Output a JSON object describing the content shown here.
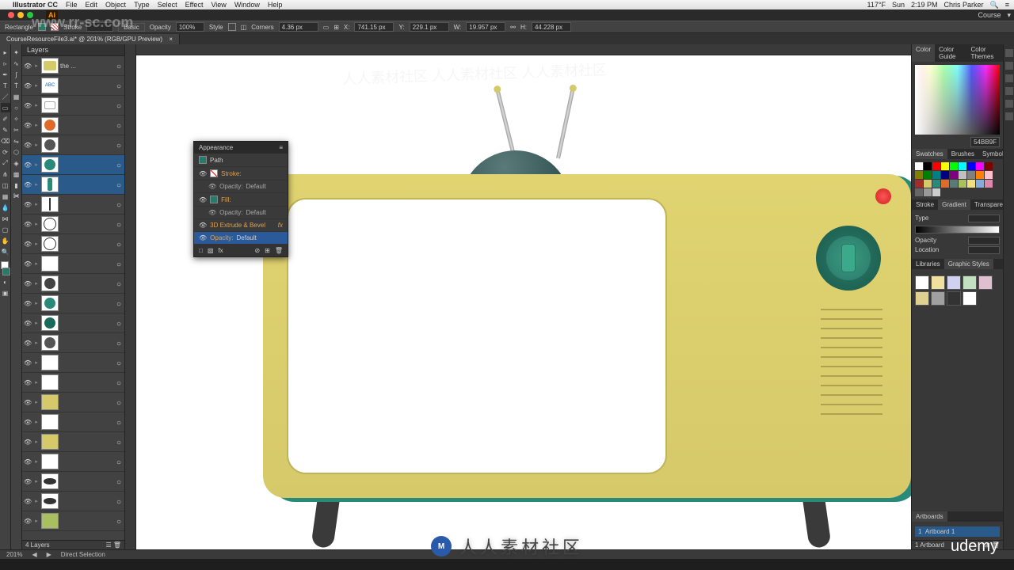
{
  "mac": {
    "app": "Illustrator CC",
    "menus": [
      "File",
      "Edit",
      "Object",
      "Type",
      "Select",
      "Effect",
      "View",
      "Window",
      "Help"
    ],
    "right": {
      "temp": "117°F",
      "day": "Sun",
      "time": "2:19 PM",
      "user": "Chris Parker"
    }
  },
  "app_right_menu": {
    "workspace": "Course"
  },
  "ctrl": {
    "tool": "Rectangle",
    "stroke": "Stroke",
    "style_lbl": "Style",
    "opacity_lbl": "Opacity",
    "opacity": "100%",
    "corners_lbl": "Corners",
    "corners": "4.36 px",
    "x": "741.15 px",
    "y": "229.1 px",
    "w": "19.957 px",
    "h": "44.228 px",
    "basic": "Basic"
  },
  "doc": {
    "tab": "CourseResourceFile3.ai* @ 201% (RGB/GPU Preview)"
  },
  "layers": {
    "title": "Layers",
    "items": [
      {
        "name": "the ...",
        "thumb": "tv",
        "sel": false
      },
      {
        "name": "",
        "thumb": "title",
        "sel": false
      },
      {
        "name": "",
        "thumb": "screen",
        "sel": false
      },
      {
        "name": "",
        "thumb": "circle",
        "color": "#e06a2a",
        "sel": false
      },
      {
        "name": "",
        "thumb": "circle",
        "color": "#555",
        "sel": false
      },
      {
        "name": "",
        "thumb": "circle",
        "color": "#2a8a7a",
        "sel": true
      },
      {
        "name": "",
        "thumb": "knob",
        "sel": true
      },
      {
        "name": "",
        "thumb": "line",
        "sel": false
      },
      {
        "name": "",
        "thumb": "clock",
        "sel": false
      },
      {
        "name": "",
        "thumb": "clock",
        "sel": false
      },
      {
        "name": "",
        "thumb": "blank",
        "sel": false
      },
      {
        "name": "",
        "thumb": "circle",
        "color": "#444",
        "sel": false
      },
      {
        "name": "",
        "thumb": "circle",
        "color": "#2a8a7a",
        "sel": false
      },
      {
        "name": "",
        "thumb": "circle",
        "color": "#1a6a5a",
        "sel": false
      },
      {
        "name": "",
        "thumb": "circle",
        "color": "#555",
        "sel": false
      },
      {
        "name": "",
        "thumb": "blank",
        "sel": false
      },
      {
        "name": "",
        "thumb": "blank",
        "sel": false
      },
      {
        "name": "",
        "thumb": "bar",
        "color": "#d6c96a",
        "sel": false
      },
      {
        "name": "",
        "thumb": "blank",
        "sel": false
      },
      {
        "name": "",
        "thumb": "bar",
        "color": "#d6c96a",
        "sel": false
      },
      {
        "name": "",
        "thumb": "blank",
        "sel": false
      },
      {
        "name": "",
        "thumb": "ellipse",
        "color": "#333",
        "sel": false
      },
      {
        "name": "",
        "thumb": "ellipse",
        "color": "#333",
        "sel": false
      },
      {
        "name": "",
        "thumb": "rect",
        "color": "#aac060",
        "sel": false
      }
    ],
    "footer": "4 Layers"
  },
  "appearance": {
    "title": "Appearance",
    "object": "Path",
    "rows": [
      {
        "label": "Stroke:",
        "swatch": "none"
      },
      {
        "label": "Opacity:",
        "value": "Default",
        "sub": true
      },
      {
        "label": "Fill:",
        "swatch": "#2a7a6a"
      },
      {
        "label": "Opacity:",
        "value": "Default",
        "sub": true
      },
      {
        "label": "3D Extrude & Bevel",
        "fx": true
      },
      {
        "label": "Opacity:",
        "value": "Default",
        "sel": true
      }
    ]
  },
  "panels": {
    "color": {
      "tabs": [
        "Color",
        "Color Guide",
        "Color Themes"
      ],
      "hex": "54BB9F"
    },
    "swatches": {
      "tabs": [
        "Swatches",
        "Brushes",
        "Symbols"
      ],
      "colors": [
        "#ffffff",
        "#000000",
        "#ff0000",
        "#ffff00",
        "#00ff00",
        "#00ffff",
        "#0000ff",
        "#ff00ff",
        "#800000",
        "#808000",
        "#008000",
        "#008080",
        "#000080",
        "#800080",
        "#c0c0c0",
        "#808080",
        "#ff8000",
        "#ffc0cb",
        "#a52a2a",
        "#d6c96a",
        "#2a8a7a",
        "#e06a2a",
        "#5a7a7a",
        "#aac060",
        "#f0e080",
        "#88aadd",
        "#dd88aa",
        "#666",
        "#999",
        "#ccc"
      ]
    },
    "gradient": {
      "tabs": [
        "Stroke",
        "Gradient",
        "Transparency"
      ],
      "type_lbl": "Type",
      "type": "",
      "opacity_lbl": "Opacity",
      "location_lbl": "Location"
    },
    "libs": {
      "tabs": [
        "Libraries",
        "Graphic Styles"
      ],
      "styles": [
        "#fff",
        "#f0e0a0",
        "#d0d0f0",
        "#c0e0c0",
        "#e0c0d0",
        "#e0d090",
        "#a0a0a0",
        "#333333",
        "#ffffff"
      ]
    },
    "artboards": {
      "tabs": [
        "Artboards"
      ],
      "item": "Artboard 1",
      "footer": "1 Artboard"
    }
  },
  "status": {
    "zoom": "201%",
    "tool": "Direct Selection"
  },
  "brand": {
    "zh": "人人素材社区",
    "udemy": "udemy",
    "badge": "M",
    "site": "www.rr-sc.com"
  }
}
